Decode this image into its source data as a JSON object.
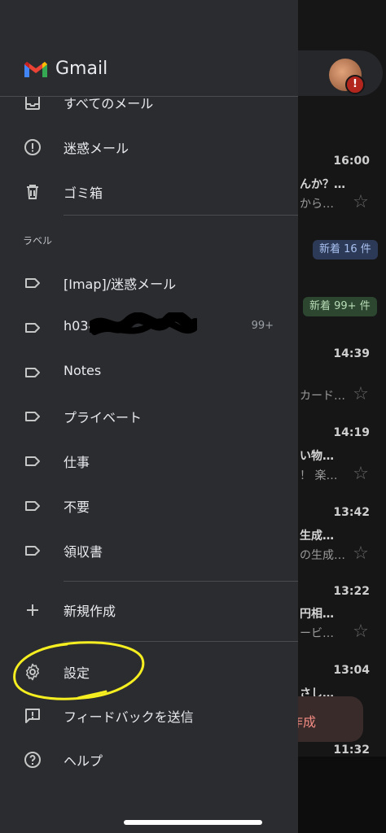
{
  "app": {
    "title": "Gmail"
  },
  "drawer": {
    "items_top": [
      {
        "key": "all-mail",
        "label": "すべてのメール",
        "icon": "all-mail-icon"
      },
      {
        "key": "spam",
        "label": "迷惑メール",
        "icon": "spam-icon"
      },
      {
        "key": "trash",
        "label": "ゴミ箱",
        "icon": "trash-icon"
      }
    ],
    "labels_section": "ラベル",
    "labels": [
      {
        "label": "[Imap]/迷惑メール",
        "icon": "label-icon"
      },
      {
        "label": "h034",
        "count": "99+",
        "icon": "label-icon"
      },
      {
        "label": "Notes",
        "icon": "label-icon"
      },
      {
        "label": "プライベート",
        "icon": "label-icon"
      },
      {
        "label": "仕事",
        "icon": "label-icon"
      },
      {
        "label": "不要",
        "icon": "label-icon"
      },
      {
        "label": "領収書",
        "icon": "label-icon"
      }
    ],
    "new_label": "新規作成",
    "settings": "設定",
    "feedback": "フィードバックを送信",
    "help": "ヘルプ"
  },
  "inbox_background": {
    "rows": [
      {
        "time": "16:00",
        "subject": "んか？…",
        "snippet": "から…"
      },
      {
        "time": "14:39",
        "subject": "",
        "snippet": "カード…"
      },
      {
        "time": "14:19",
        "subject": "い物…",
        "snippet": "！ 楽…"
      },
      {
        "time": "13:42",
        "subject": "生成…",
        "snippet": "の生成…"
      },
      {
        "time": "13:22",
        "subject": "円相…",
        "snippet": "ービ…"
      },
      {
        "time": "13:04",
        "subject": "さし…",
        "snippet": ""
      },
      {
        "time": "11:32",
        "subject": "",
        "snippet": ""
      }
    ],
    "badge_new_blue": "新着 16 件",
    "badge_new_green": "新着 99+ 件",
    "compose_label": "作成",
    "avatar_alert": "!"
  },
  "colors": {
    "drawer_bg": "#2b2c2f",
    "accent_highlight": "#ffeb3b",
    "compose_text": "#f28b82"
  }
}
